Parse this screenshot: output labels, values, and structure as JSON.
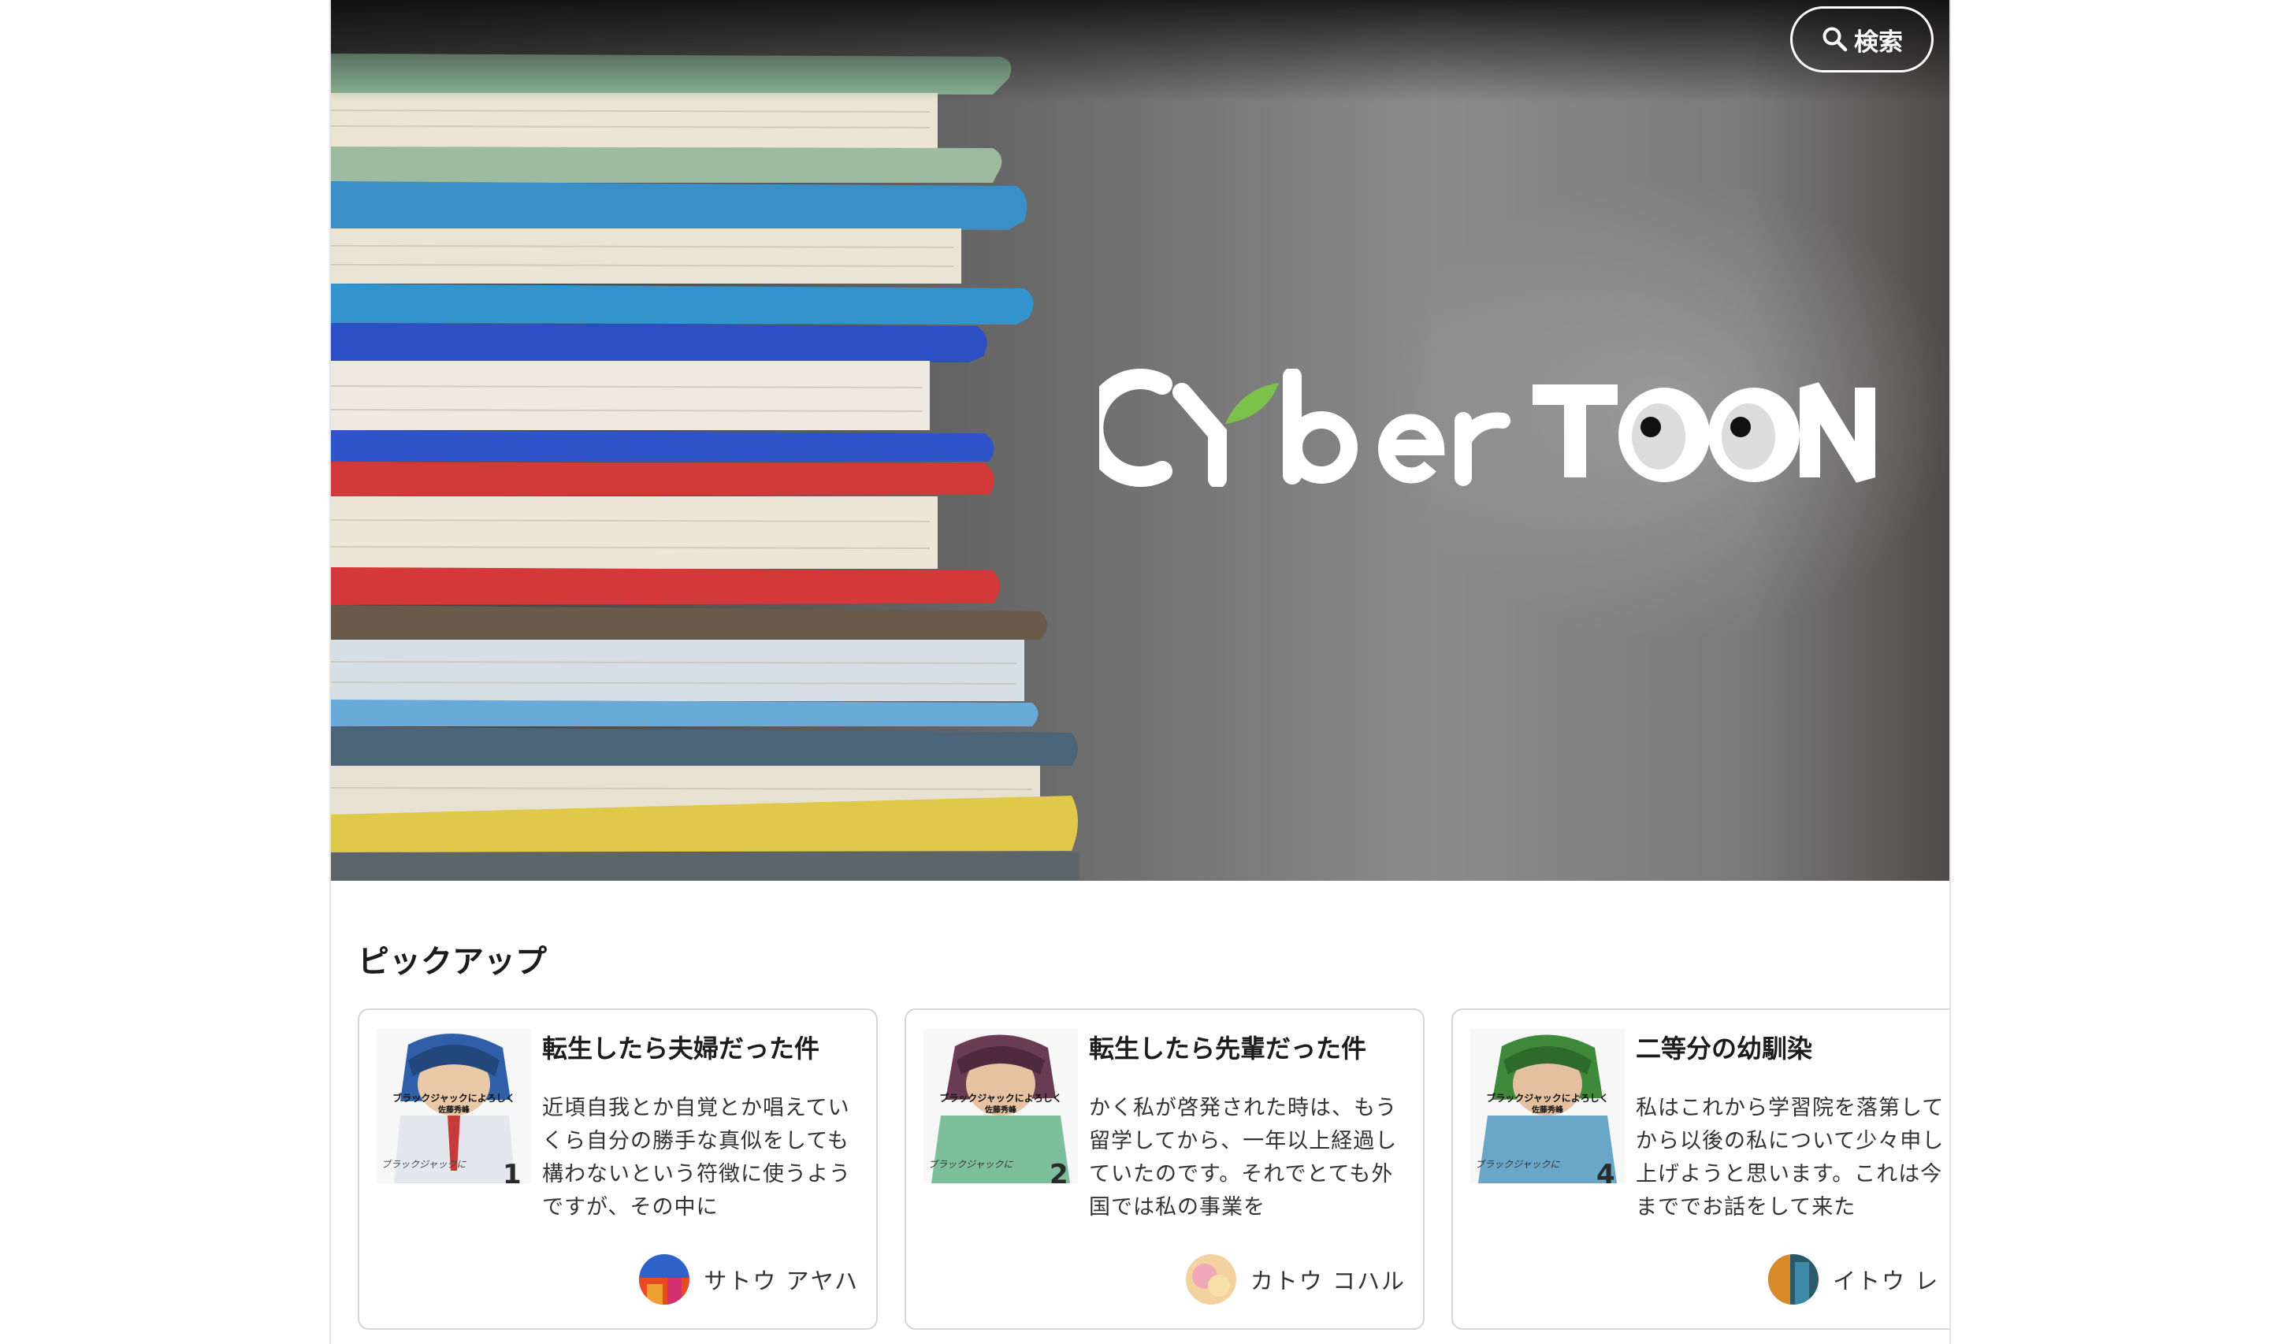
{
  "header": {
    "search_label": "検索",
    "logo_text": "CYber TOON"
  },
  "pickup": {
    "title": "ピックアップ",
    "cards": [
      {
        "title": "転生したら夫婦だった件",
        "body": "近頃自我とか自覚とか唱えていくら自分の勝手な真似をしても構わないという符徴に使うようですが、その中に",
        "author": "サトウ アヤハ",
        "cover_text_top": "ブラックジャックによろしく",
        "cover_text_author": "佐藤秀峰",
        "cover_text_bottom": "ブラックジャックに",
        "volume": "1"
      },
      {
        "title": "転生したら先輩だった件",
        "body": "かく私が啓発された時は、もう留学してから、一年以上経過していたのです。それでとても外国では私の事業を",
        "author": "カトウ コハル",
        "cover_text_top": "ブラックジャックによろしく",
        "cover_text_author": "佐藤秀峰",
        "cover_text_bottom": "ブラックジャックに",
        "volume": "2"
      },
      {
        "title": "二等分の幼馴染",
        "body": "私はこれから学習院を落第してから以後の私について少々申し上げようと思います。これは今まででお話をして来た",
        "author": "イトウ レ",
        "cover_text_top": "ブラックジャックによろしく",
        "cover_text_author": "佐藤秀峰",
        "cover_text_bottom": "ブラックジャックに",
        "volume": "4"
      }
    ]
  },
  "colors": {
    "logo_white": "#ffffff",
    "logo_leaf": "#7cc24a",
    "card_border": "#d6d6d6",
    "text_dark": "#1c1c1c"
  }
}
